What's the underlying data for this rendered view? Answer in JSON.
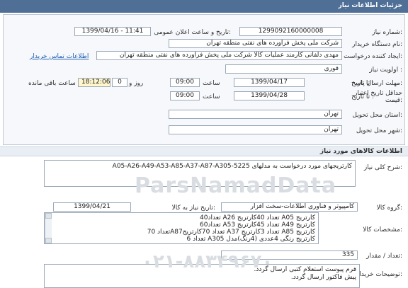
{
  "header": {
    "title": "جزئیات اطلاعات نیاز"
  },
  "fields": {
    "need_number_label": "شماره نیاز:",
    "need_number": "1299092160000008",
    "announce_label": "تاریخ و ساعت اعلان عمومی:",
    "announce_value": "1399/04/16 - 11:41",
    "buyer_org_label": "نام دستگاه خریدار:",
    "buyer_org": "شرکت ملی پخش فراورده های نفتی منطقه تهران",
    "requester_label": "ایجاد کننده درخواست:",
    "requester": "مهدی دلفانی کارمند عملیات کالا شرکت ملی پخش فراورده های نفتی منطقه تهران",
    "contact_link": "اطلاعات تماس خریدار",
    "priority_label": "اولویت نیاز :",
    "priority": "فوری",
    "reply_deadline_label": "مهلت ارسال پاسخ:",
    "until_date_label": "تا تاریخ :",
    "reply_date": "1399/04/17",
    "time_label": "ساعت",
    "reply_time": "09:00",
    "days_value": "0",
    "days_label": "روز و",
    "remaining_time": "18:12:06",
    "remaining_label": "ساعت باقی مانده",
    "validity_label": "حداقل تاریخ اعتبار",
    "validity_label2": "قیمت:",
    "validity_until_label": "تا تاریخ :",
    "validity_date": "1399/04/28",
    "validity_time_label": "ساعت",
    "validity_time": "09:00",
    "province_label": "استان محل تحویل:",
    "province": "تهران",
    "city_label": "شهر محل تحویل:",
    "city": "تهران"
  },
  "goods": {
    "section_title": "اطلاعات کالاهای مورد نیاز",
    "summary_label": "شرح کلی نیاز:",
    "summary": "کارتریجهای مورد درخواست به مدلهای A05-A26-A49-A53-A85-A37-A87-A305-5225",
    "group_label": "گروه کالا:",
    "group": "کامپیوتر و فناوری اطلاعات-سخت افزار",
    "need_date_label": "تاریخ نیاز به کالا:",
    "need_date": "1399/04/21",
    "specs_label": "مشخصات کالا:",
    "specs_lines": [
      "کارتریج A05 تعداد 40کارتریج A26 تعداد40",
      "کارتریج A49 تعداد 45کارتریج A53 تعداد60",
      "کارتریج A85 تعداد 3کارتریج A37 تعداد 70کارتریجA87تعداد 70",
      "کارتریج رنگی 4عددی (4رنگ)مدل A305 تعداد 6"
    ],
    "qty_label": "تعداد / مقدار:",
    "qty": "335",
    "desc_label": "توضیحات خریدار:",
    "desc_lines": [
      "فرم پیوست استعلام کتبی ارسال گردد.",
      "پیش فاکتور ارسال گردد."
    ]
  },
  "watermark": {
    "text": "ParsNamadData",
    "phone": "۰۲۱-۸۸۳۴۹۶۷۰"
  }
}
